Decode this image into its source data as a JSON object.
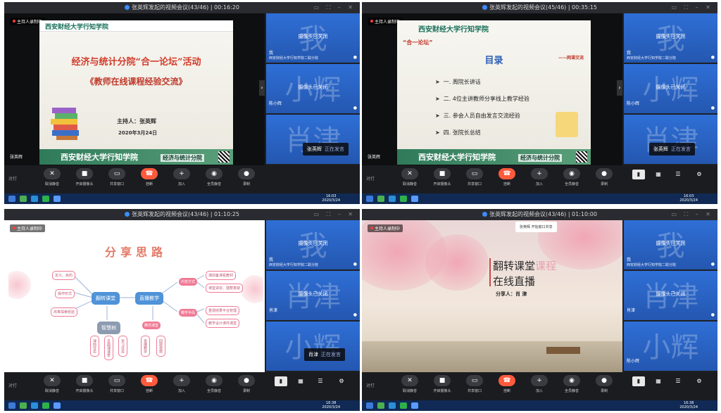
{
  "common": {
    "rec_label": "主持人录制中",
    "camera_off": "摄像头已关闭",
    "speaking_label": "正在发言",
    "toolbar_left": "对打",
    "toolbar": [
      "取消静音",
      "开启摄像头",
      "共享窗口",
      "挂断",
      "加入",
      "全员静音",
      "录制"
    ],
    "view_labels": [
      "演讲",
      "宫格",
      "列表",
      "设置"
    ],
    "clock_time": "16:03",
    "clock_date": "2020/3/24",
    "ghost_me": "我",
    "ghost_hui": "小辉",
    "ghost_jin": "肖津",
    "org": "西安财经大学行知学院二联分院",
    "me": "我",
    "chen": "陈小辉",
    "xiao": "肖津",
    "host": "张英辉"
  },
  "q1": {
    "title": "张英辉发起的视频会议(43/46) | 00:16:20",
    "slide": {
      "logo": "西安财经大学行知学院",
      "title1": "经济与统计分院“合一论坛”活动",
      "title2": "《教师在线课程经验交流》",
      "host": "主持人：张英辉",
      "date": "2020年3月24日",
      "footer_school": "西安财经大学行知学院",
      "footer_dept": "经济与统计分院"
    }
  },
  "q2": {
    "title": "张英辉发起的视频会议(45/46) | 00:35:15",
    "slide": {
      "logo": "西安财经大学行知学院",
      "forum": "“合一论坛”",
      "subtitle": "——网课交流",
      "heading": "目录",
      "items": [
        "一. 周院长讲话",
        "二. 4位主讲教师分享线上教学经验",
        "三. 参会人员自由发言交流经验",
        "四. 张院长总结"
      ],
      "footer_school": "西安财经大学行知学院",
      "footer_dept": "经济与统计分院"
    }
  },
  "q3": {
    "title": "张英辉发起的视频会议(43/46) | 01:10:25",
    "clock_time": "16:38",
    "slide": {
      "title": "分享思路",
      "center_left": "翻转课堂",
      "center_right": "直播教学",
      "left_nodes": [
        "定义、目的",
        "操作形式",
        "改革探索经验"
      ],
      "right_top": "内容方式",
      "right_mid": "教学手段",
      "right_leaves": [
        "课前备课看教材",
        "课堂讲授、建群答疑",
        "重视结果平台管理",
        "教学设计课件课堂"
      ],
      "smart_tree": "智慧树",
      "tencent": "腾讯课堂",
      "tree_leaves": [
        "课前任务",
        "见面课课堂",
        "学习任务"
      ],
      "tencent_leaves": [
        "直播教学",
        "回顾视频"
      ]
    }
  },
  "q4": {
    "title": "张英辉发起的视频会议(43/46) | 01:10:00",
    "toast": "张英辉 开始窗口共享",
    "clock_time": "16:38",
    "slide": {
      "line1": "翻转课堂",
      "line1_hl": "课程",
      "line2": "在线直播",
      "sharer": "分享人：肖 津"
    }
  }
}
